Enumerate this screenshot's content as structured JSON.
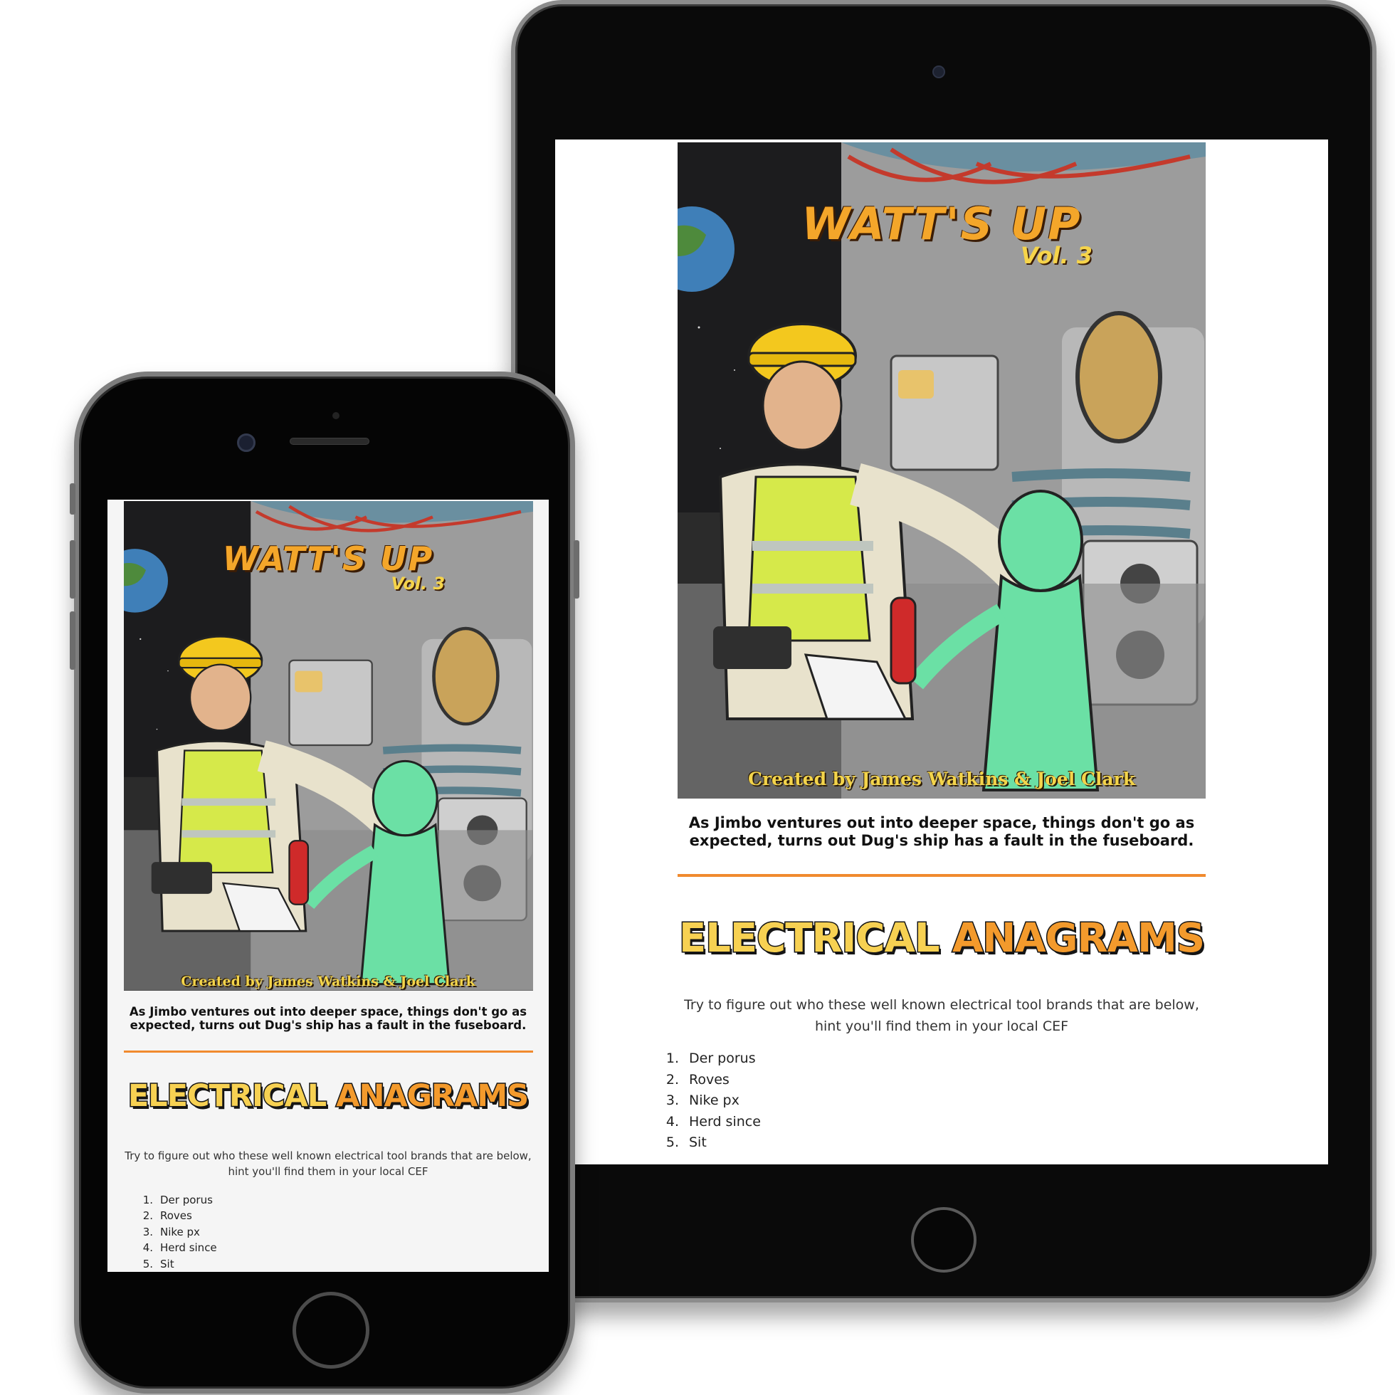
{
  "cover": {
    "title": "WATT'S UP",
    "volume": "Vol. 3",
    "credit": "Created by James Watkins & Joel Clark"
  },
  "blurb": "As Jimbo ventures out into deeper space, things don't go as expected, turns out Dug's ship has a fault in the fuseboard.",
  "section": {
    "heading_word1": "ELECTRICAL",
    "heading_word2": "ANAGRAMS",
    "intro": "Try to figure out who these well known electrical tool brands that are below, hint you'll find them in your local CEF",
    "items": [
      {
        "num": "1.",
        "text": "Der porus"
      },
      {
        "num": "2.",
        "text": "Roves"
      },
      {
        "num": "3.",
        "text": "Nike px"
      },
      {
        "num": "4.",
        "text": "Herd since"
      },
      {
        "num": "5.",
        "text": "Sit"
      }
    ]
  },
  "colors": {
    "accent_orange": "#f08a2e",
    "heading_yellow": "#f7d152",
    "heading_orange": "#f39a2c",
    "device_body": "#0a0a0a"
  }
}
